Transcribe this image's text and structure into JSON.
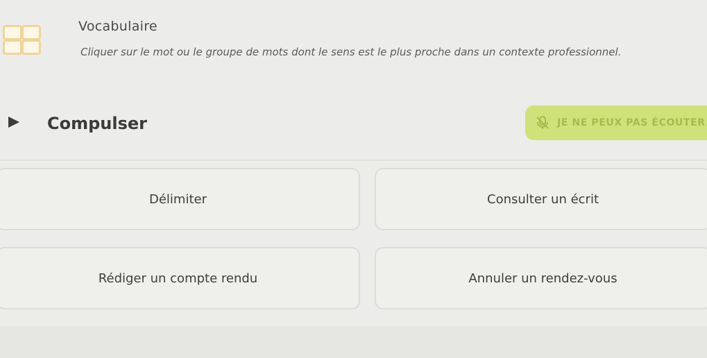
{
  "header": {
    "icon": "grid-icon",
    "title": "Vocabulaire",
    "instruction": "Cliquer sur le mot ou le groupe de mots dont le sens est le plus proche dans un contexte professionnel."
  },
  "prompt": {
    "play_icon": "play-icon",
    "word": "Compulser",
    "cant_listen_icon": "muted-microphone-icon",
    "cant_listen_label": "JE NE PEUX PAS ÉCOUTER"
  },
  "choices": [
    {
      "label": "Délimiter"
    },
    {
      "label": "Consulter un écrit"
    },
    {
      "label": "Rédiger un compte rendu"
    },
    {
      "label": "Annuler un rendez-vous"
    }
  ],
  "colors": {
    "background": "#ececea",
    "accent_button": "#cfe27a",
    "accent_text": "#a8b84c",
    "icon_border": "#f0d49a"
  }
}
